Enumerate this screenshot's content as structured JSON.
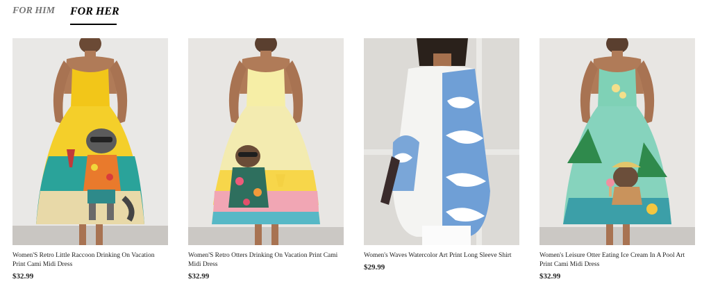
{
  "tabs": [
    {
      "label": "FOR HIM",
      "active": false
    },
    {
      "label": "FOR HER",
      "active": true
    }
  ],
  "products": [
    {
      "title": "Women'S Retro Little Raccoon Drinking On Vacation Print Cami Midi Dress",
      "price": "$32.99",
      "image_subject": "yellow cami midi dress with raccoon print"
    },
    {
      "title": "Women'S Retro Otters Drinking On Vacation Print Cami Midi Dress",
      "price": "$32.99",
      "image_subject": "pale yellow cami midi dress with otter print"
    },
    {
      "title": "Women's Waves Watercolor Art Print Long Sleeve Shirt",
      "price": "$29.99",
      "image_subject": "white long sleeve shirt with blue wave print"
    },
    {
      "title": "Women's Leisure Otter Eating Ice Cream In A Pool Art Print Cami Midi Dress",
      "price": "$32.99",
      "image_subject": "mint green cami midi dress with otter in pool print"
    }
  ],
  "colors": {
    "accent": "#000000",
    "inactive_tab": "#777777",
    "text": "#222222"
  }
}
